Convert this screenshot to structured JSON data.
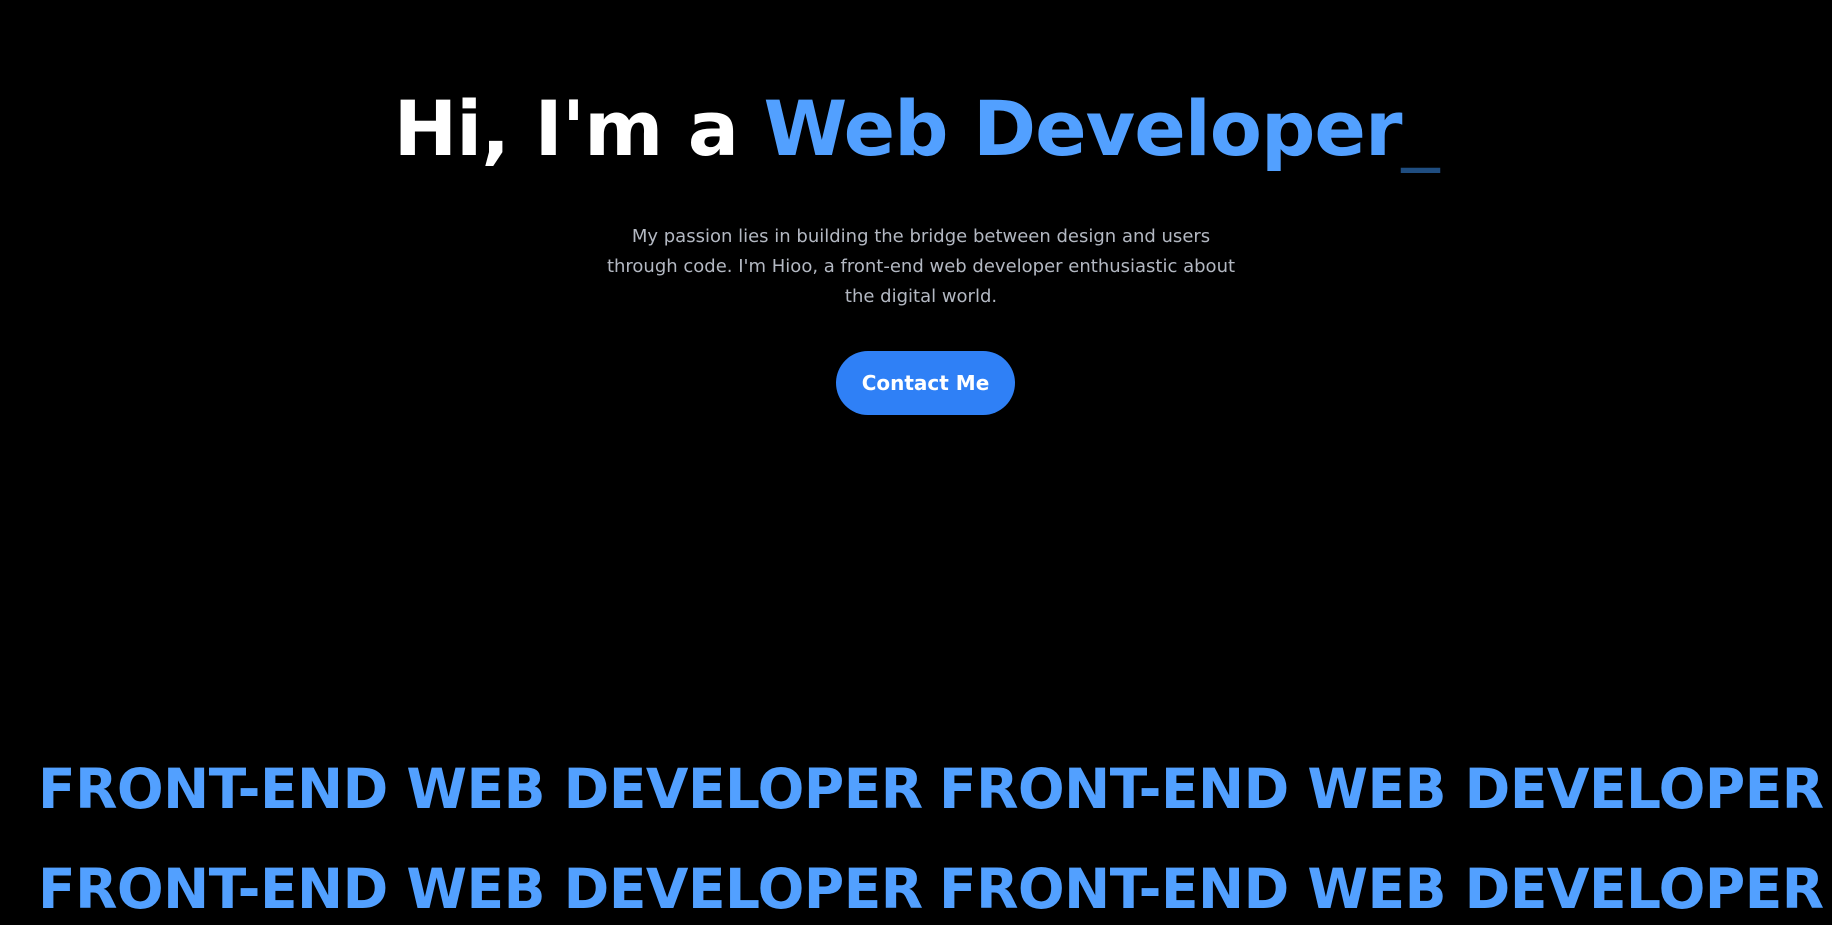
{
  "hero": {
    "greeting": "Hi, I'm a ",
    "role": "Web Developer",
    "cursor": "_",
    "intro": "My passion lies in building the bridge between design and users through code. I'm Hioo, a front-end web developer enthusiastic about the digital world.",
    "cta_label": "Contact Me"
  },
  "marquee": {
    "rows": [
      [
        "FRONT-END WEB DEVELOPER",
        "FRONT-END WEB DEVELOPER"
      ],
      [
        "FRONT-END WEB DEVELOPER",
        "FRONT-END WEB DEVELOPER"
      ]
    ]
  },
  "colors": {
    "background": "#000000",
    "accent": "#52a0ff",
    "button": "#2f80f6",
    "body_text": "#b3b8c2"
  }
}
